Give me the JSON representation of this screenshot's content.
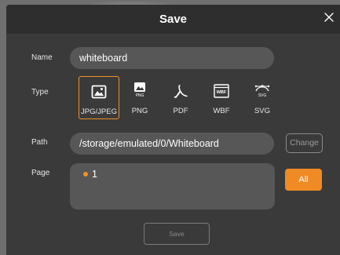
{
  "dialog": {
    "title": "Save"
  },
  "name": {
    "label": "Name",
    "value": "whiteboard"
  },
  "type": {
    "label": "Type",
    "options": [
      {
        "label": "JPG/JPEG",
        "icon": "image-icon",
        "selected": true
      },
      {
        "label": "PNG",
        "icon": "png-icon",
        "badge": "PNG",
        "selected": false
      },
      {
        "label": "PDF",
        "icon": "pdf-icon",
        "selected": false
      },
      {
        "label": "WBF",
        "icon": "wbf-icon",
        "badge": "WBF",
        "selected": false
      },
      {
        "label": "SVG",
        "icon": "svg-icon",
        "badge": "SVG",
        "selected": false
      }
    ]
  },
  "path": {
    "label": "Path",
    "value": "/storage/emulated/0/Whiteboard",
    "change_label": "Change"
  },
  "page": {
    "label": "Page",
    "items": [
      "1"
    ],
    "all_label": "All"
  },
  "footer": {
    "save_label": "Save"
  },
  "colors": {
    "accent": "#f08a24",
    "dialog_bg": "#3a3a3a",
    "field_bg": "#575757"
  }
}
